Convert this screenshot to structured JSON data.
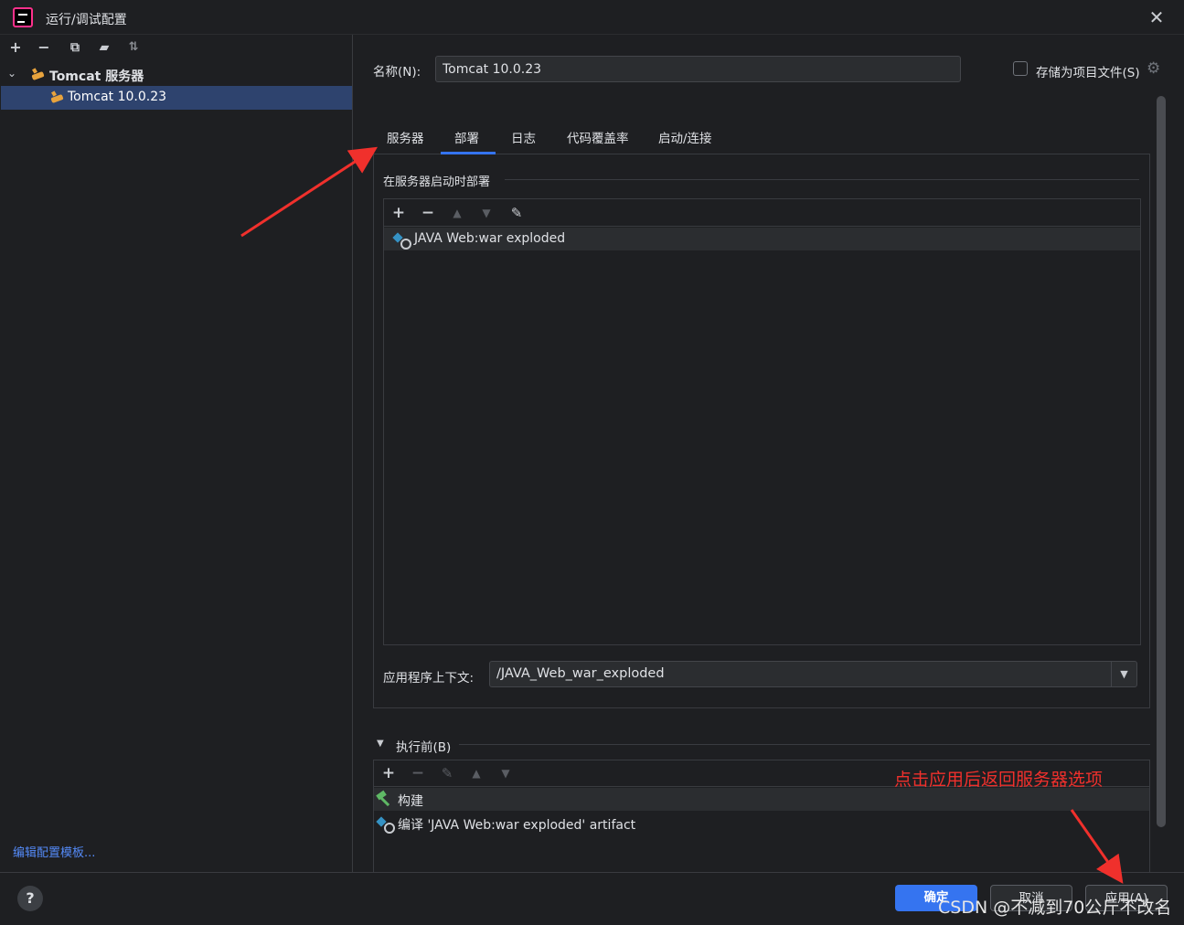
{
  "window": {
    "title": "运行/调试配置"
  },
  "left": {
    "tree_group": "Tomcat 服务器",
    "tree_item": "Tomcat 10.0.23",
    "edit_templates": "编辑配置模板..."
  },
  "config": {
    "name_label": "名称(N):",
    "name_value": "Tomcat 10.0.23",
    "store_label": "存储为项目文件(S)",
    "store_checked": false
  },
  "tabs": [
    {
      "label": "服务器"
    },
    {
      "label": "部署",
      "active": true
    },
    {
      "label": "日志"
    },
    {
      "label": "代码覆盖率"
    },
    {
      "label": "启动/连接"
    }
  ],
  "deploy": {
    "title": "在服务器启动时部署",
    "artifacts": [
      "JAVA Web:war exploded"
    ],
    "context_label": "应用程序上下文:",
    "context_value": "/JAVA_Web_war_exploded"
  },
  "before_launch": {
    "label": "执行前(B)",
    "tasks": [
      "构建",
      "编译 'JAVA Web:war exploded' artifact"
    ]
  },
  "annotation": {
    "text": "点击应用后返回服务器选项",
    "color": "#f0302c"
  },
  "buttons": {
    "help": "?",
    "ok": "确定",
    "cancel": "取消",
    "apply": "应用(A)"
  },
  "watermark": "CSDN @不减到70公斤不改名",
  "colors": {
    "accent": "#3574f0",
    "selection": "#2e436e",
    "background": "#1e1f22"
  }
}
